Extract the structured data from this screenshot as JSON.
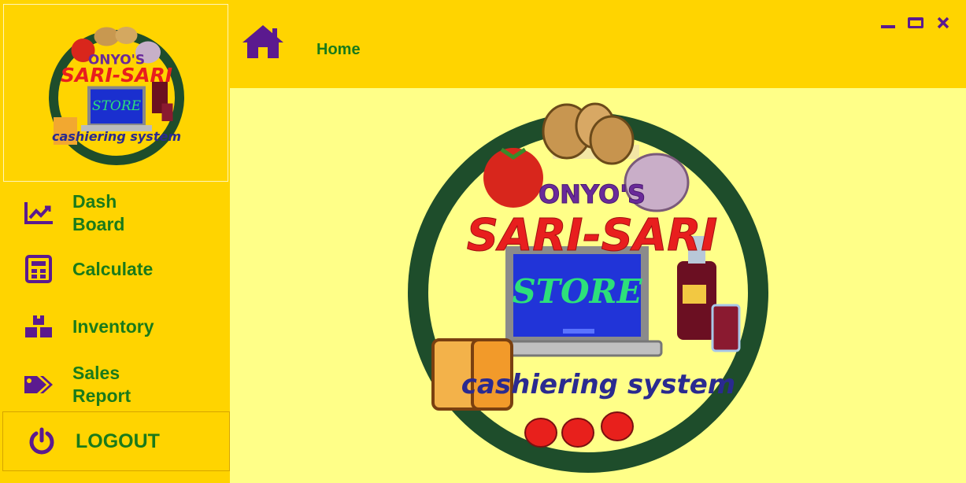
{
  "colors": {
    "sidebar_bg": "#ffd400",
    "content_bg": "#ffff88",
    "nav_text": "#1a7a1a",
    "icon_purple": "#5b1a8f"
  },
  "header": {
    "home_icon": "house-icon",
    "title": "Home",
    "window_controls": [
      "minimize-icon",
      "maximize-icon",
      "close-icon"
    ]
  },
  "sidebar": {
    "logo_alt": "logo",
    "items": [
      {
        "label": "Dash\nBoard",
        "icon": "chart-line-icon"
      },
      {
        "label": "Calculate",
        "icon": "calculator-icon"
      },
      {
        "label": "Inventory",
        "icon": "boxes-icon"
      },
      {
        "label": "Sales\nReport",
        "icon": "tags-icon"
      },
      {
        "label": "LOGOUT",
        "icon": "power-icon"
      }
    ]
  },
  "logo": {
    "top_text": "ONYO'S",
    "middle_text": "SARI-SARI",
    "screen_text": "STORE",
    "bottom_text": "cashiering system"
  }
}
